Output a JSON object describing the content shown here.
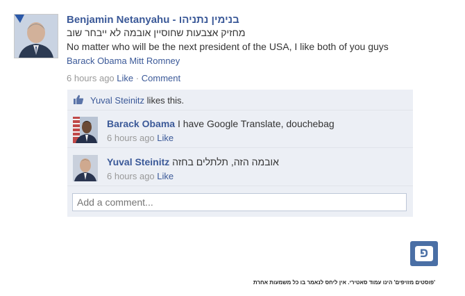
{
  "post": {
    "author": "Benjamin Netanyahu - בנימין נתניהו",
    "text_hebrew": "מחזיק אצבעות שחוסיין אובמה לא ייבחר שוב",
    "text_english": "No matter who will be the next president of the USA, I like both of you guys",
    "tags": "Barack Obama Mitt Romney",
    "time": "6 hours ago",
    "like_label": "Like",
    "dot": "·",
    "comment_label": "Comment"
  },
  "likes": {
    "name": "Yuval Steinitz",
    "suffix": "likes this."
  },
  "comments": [
    {
      "author": "Barack Obama",
      "text": "I have Google Translate, douchebag",
      "time": "6 hours ago",
      "like_label": "Like"
    },
    {
      "author": "Yuval Steinitz",
      "text": "אובמה הזה, תלתלים בחזה",
      "time": "6 hours ago",
      "like_label": "Like"
    }
  ],
  "comment_box": {
    "placeholder": "Add a comment..."
  },
  "logo": {
    "glyph": "פ"
  },
  "disclaimer": "'פוסטים מזויפים' הינו עמוד סאטירי. אין ליחס לנאמר בו כל משמעות אחרת",
  "colors": {
    "link": "#3b5998",
    "panel": "#eceff5",
    "logo_bg": "#4a6fa5"
  }
}
